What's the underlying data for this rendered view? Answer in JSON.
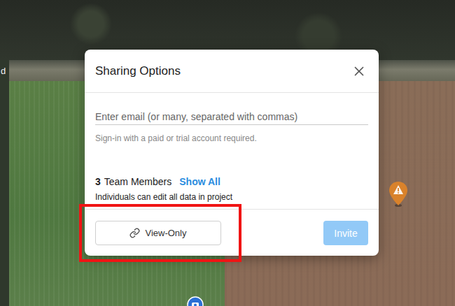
{
  "map": {
    "edge_label": "d",
    "pins": [
      {
        "kind": "warning",
        "color": "#d9822b"
      },
      {
        "kind": "photo",
        "color": "#2a6fd6"
      }
    ]
  },
  "dialog": {
    "title": "Sharing Options",
    "email": {
      "placeholder": "Enter email (or many, separated with commas)",
      "value": ""
    },
    "hint": "Sign-in with a paid or trial account required.",
    "team": {
      "count": "3",
      "label": "Team Members",
      "link": "Show All"
    },
    "note": "Individuals can edit all data in project",
    "buttons": [
      {
        "label": "View-Only",
        "kind": "link",
        "disabled": false,
        "highlighted": true
      },
      {
        "label": "Invite",
        "kind": "primary",
        "disabled": true,
        "highlighted": false
      }
    ]
  }
}
